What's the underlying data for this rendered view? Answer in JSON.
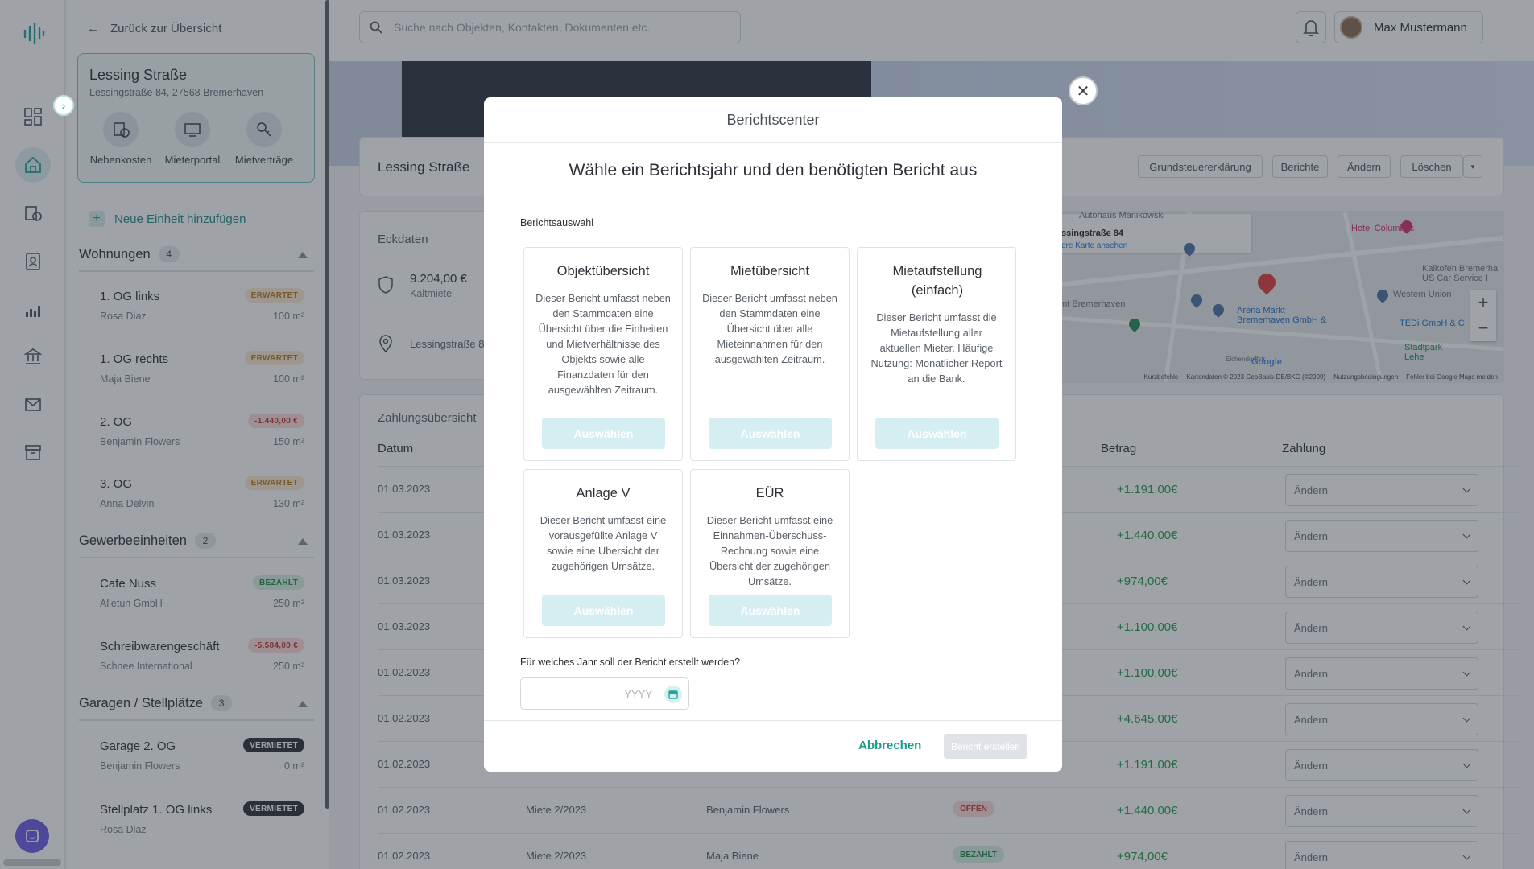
{
  "sidebar": {
    "back_label": "Zurück zur Übersicht",
    "property": {
      "name": "Lessing Straße",
      "address": "Lessingstraße 84, 27568 Bremerhaven",
      "actions": [
        "Nebenkosten",
        "Mieterportal",
        "Mietverträge"
      ]
    },
    "add_unit_label": "Neue Einheit hinzufügen",
    "groups": [
      {
        "label": "Wohnungen",
        "count": "4"
      },
      {
        "label": "Gewerbeeinheiten",
        "count": "2"
      },
      {
        "label": "Garagen / Stellplätze",
        "count": "3"
      }
    ],
    "units": [
      {
        "name": "1. OG links",
        "tenant": "Rosa Diaz",
        "size": "100 m²",
        "badge": "ERWARTET"
      },
      {
        "name": "1. OG rechts",
        "tenant": "Maja Biene",
        "size": "100 m²",
        "badge": "ERWARTET"
      },
      {
        "name": "2. OG",
        "tenant": "Benjamin Flowers",
        "size": "150 m²",
        "badge": "-1.440,00 €"
      },
      {
        "name": "3. OG",
        "tenant": "Anna Delvin",
        "size": "130 m²",
        "badge": "ERWARTET"
      },
      {
        "name": "Cafe Nuss",
        "tenant": "Alletun GmbH",
        "size": "250 m²",
        "badge": "BEZAHLT"
      },
      {
        "name": "Schreibwarengeschäft",
        "tenant": "Schnee International",
        "size": "250 m²",
        "badge": "-5.584,00 €"
      },
      {
        "name": "Garage 2. OG",
        "tenant": "Benjamin Flowers",
        "size": "0 m²",
        "badge": "VERMIETET"
      },
      {
        "name": "Stellplatz 1. OG links",
        "tenant": "Rosa Diaz",
        "size": "",
        "badge": "VERMIETET"
      }
    ]
  },
  "topbar": {
    "search_placeholder": "Suche nach Objekten, Kontakten, Dokumenten etc.",
    "user_name": "Max Mustermann"
  },
  "object": {
    "title": "Lessing Straße",
    "buttons": [
      "Grundsteuererklärung",
      "Berichte",
      "Ändern",
      "Löschen"
    ]
  },
  "eckdaten": {
    "heading": "Eckdaten",
    "rent_value": "9.204,00 €",
    "rent_label": "Kaltmiete",
    "address": "Lessingstraße 8"
  },
  "map": {
    "labels": [
      "Autohaus Manikowski",
      "ssingstraße 84",
      "ere Karte ansehen",
      "Hotel Columbus",
      "Kalkofen Bremerha US Car Service I",
      "Western Union",
      "amt Bremerhaven",
      "Arena Markt Bremerhaven GmbH &",
      "TEDi GmbH & C",
      "Stadtpark Lehe",
      "Eichendorffstr",
      "Google"
    ],
    "footer": [
      "Kurzbefehle",
      "Kartendaten © 2023 GeoBasis-DE/BKG (©2009)",
      "Nutzungsbedingungen",
      "Fehler bei Google Maps melden"
    ]
  },
  "payments": {
    "heading": "Zahlungsübersicht",
    "columns": [
      "Datum",
      "Betrag",
      "Zahlung"
    ],
    "rows": [
      {
        "date": "01.03.2023",
        "desc": "",
        "tenant": "",
        "status": "",
        "amount": "+1.191,00€",
        "action": "Ändern"
      },
      {
        "date": "01.03.2023",
        "desc": "",
        "tenant": "",
        "status": "",
        "amount": "+1.440,00€",
        "action": "Ändern"
      },
      {
        "date": "01.03.2023",
        "desc": "",
        "tenant": "",
        "status": "",
        "amount": "+974,00€",
        "action": "Ändern"
      },
      {
        "date": "01.03.2023",
        "desc": "",
        "tenant": "",
        "status": "",
        "amount": "+1.100,00€",
        "action": "Ändern"
      },
      {
        "date": "01.02.2023",
        "desc": "",
        "tenant": "",
        "status": "",
        "amount": "+1.100,00€",
        "action": "Ändern"
      },
      {
        "date": "01.02.2023",
        "desc": "",
        "tenant": "",
        "status": "",
        "amount": "+4.645,00€",
        "action": "Ändern"
      },
      {
        "date": "01.02.2023",
        "desc": "",
        "tenant": "",
        "status": "",
        "amount": "+1.191,00€",
        "action": "Ändern"
      },
      {
        "date": "01.02.2023",
        "desc": "Miete 2/2023",
        "tenant": "Benjamin Flowers",
        "status": "OFFEN",
        "amount": "+1.440,00€",
        "action": "Ändern"
      },
      {
        "date": "01.02.2023",
        "desc": "Miete 2/2023",
        "tenant": "Maja Biene",
        "status": "BEZAHLT",
        "amount": "+974,00€",
        "action": "Ändern"
      }
    ]
  },
  "modal": {
    "title": "Berichtscenter",
    "subtitle": "Wähle ein Berichtsjahr und den benötigten Bericht aus",
    "section_label": "Berichtsauswahl",
    "reports": [
      {
        "title": "Objektübersicht",
        "desc": "Dieser Bericht umfasst neben den Stammdaten eine Übersicht über die Einheiten und Mietverhältnisse des Objekts sowie alle Finanzdaten für den ausgewählten Zeitraum.",
        "button": "Auswählen"
      },
      {
        "title": "Mietübersicht",
        "desc": "Dieser Bericht umfasst neben den Stammdaten eine Übersicht über alle Mieteinnahmen für den ausgewählten Zeitraum.",
        "button": "Auswählen"
      },
      {
        "title": "Mietaufstellung (einfach)",
        "desc": "Dieser Bericht umfasst die Mietaufstellung aller aktuellen Mieter. Häufige Nutzung: Monatlicher Report an die Bank.",
        "button": "Auswählen"
      },
      {
        "title": "Anlage V",
        "desc": "Dieser Bericht umfasst eine vorausgefüllte Anlage V sowie eine Übersicht der zugehörigen Umsätze.",
        "button": "Auswählen"
      },
      {
        "title": "EÜR",
        "desc": "Dieser Bericht umfasst eine Einnahmen-Überschuss-Rechnung sowie eine Übersicht der zugehörigen Umsätze.",
        "button": "Auswählen"
      }
    ],
    "year_question": "Für welches Jahr soll der Bericht erstellt werden?",
    "year_placeholder": "YYYY",
    "cancel_label": "Abbrechen",
    "create_label": "Bericht erstellen"
  }
}
